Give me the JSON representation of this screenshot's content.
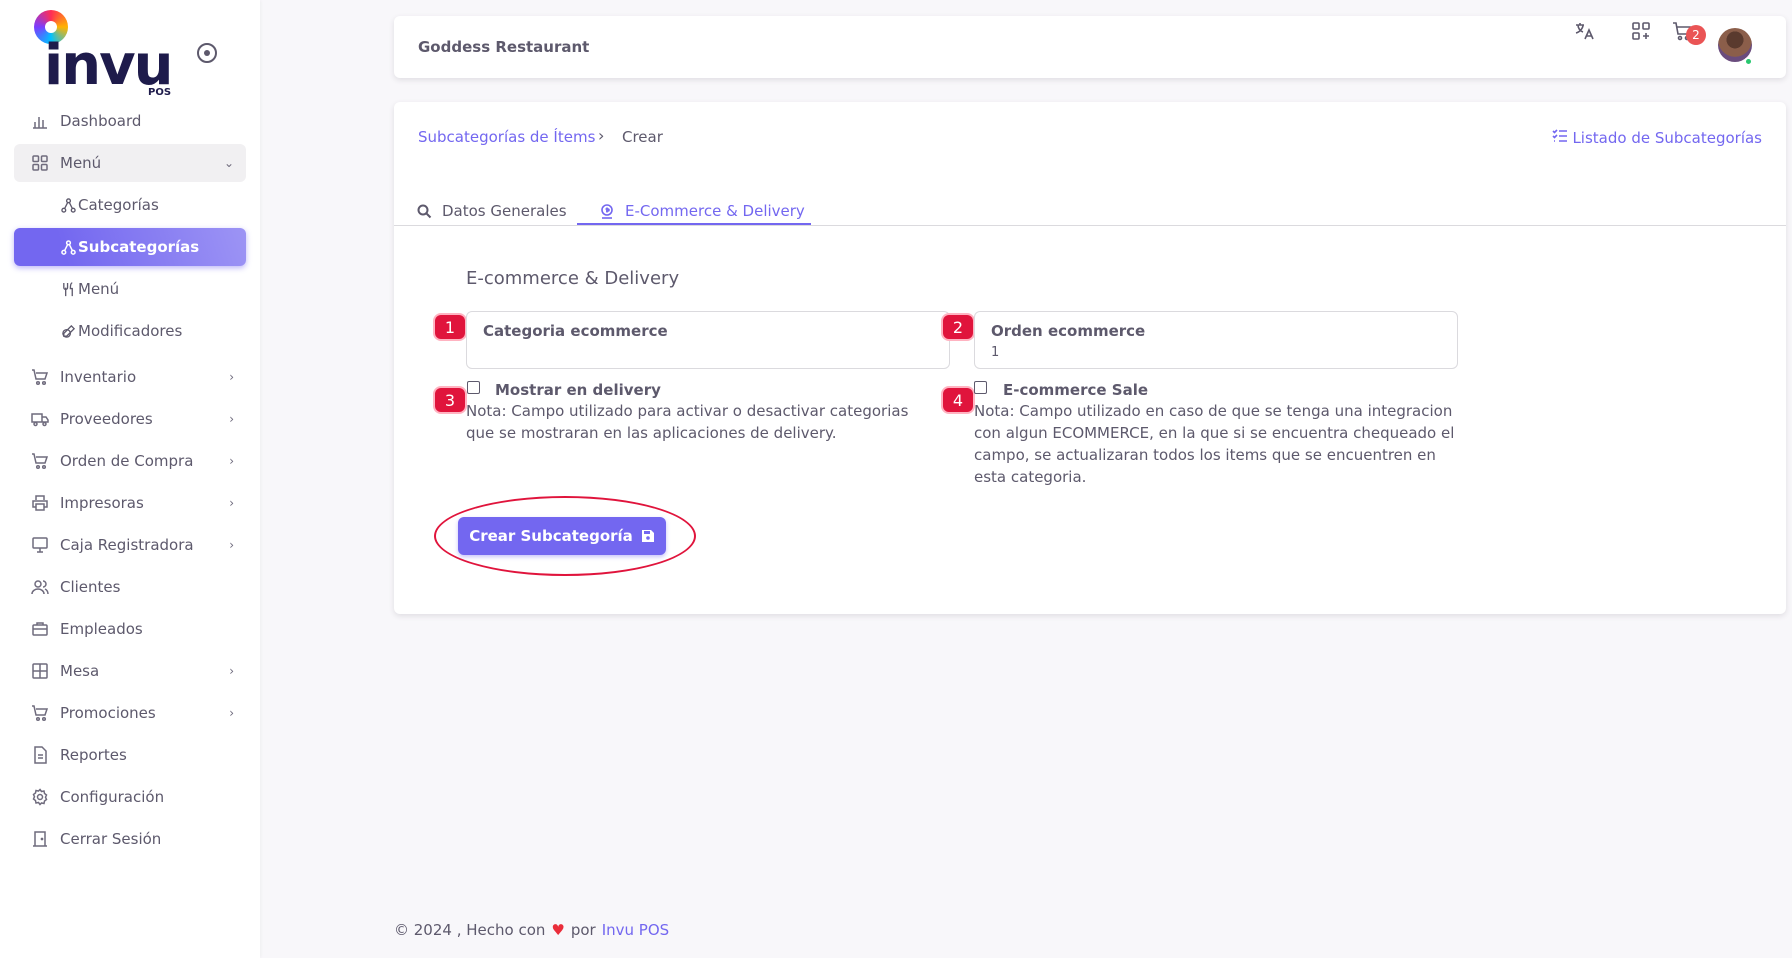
{
  "brand": {
    "logo_text": "invu",
    "logo_sub": "POS"
  },
  "sidebar": {
    "items": [
      {
        "label": "Dashboard"
      },
      {
        "label": "Menú"
      },
      {
        "label": "Categorías"
      },
      {
        "label": "Subcategorías"
      },
      {
        "label": "Menú"
      },
      {
        "label": "Modificadores"
      },
      {
        "label": "Inventario"
      },
      {
        "label": "Proveedores"
      },
      {
        "label": "Orden de Compra"
      },
      {
        "label": "Impresoras"
      },
      {
        "label": "Caja Registradora"
      },
      {
        "label": "Clientes"
      },
      {
        "label": "Empleados"
      },
      {
        "label": "Mesa"
      },
      {
        "label": "Promociones"
      },
      {
        "label": "Reportes"
      },
      {
        "label": "Configuración"
      },
      {
        "label": "Cerrar Sesión"
      }
    ]
  },
  "topbar": {
    "restaurant": "Goddess Restaurant",
    "cart_count": "2"
  },
  "breadcrumb": {
    "parent": "Subcategorías de Ítems",
    "separator": "›",
    "current": "Crear"
  },
  "list_link": "Listado de Subcategorías",
  "tabs": [
    {
      "label": "Datos Generales"
    },
    {
      "label": "E-Commerce & Delivery"
    }
  ],
  "form": {
    "section_title": "E-commerce & Delivery",
    "field1": {
      "badge": "1",
      "label": "Categoria ecommerce",
      "value": ""
    },
    "field2": {
      "badge": "2",
      "label": "Orden ecommerce",
      "value": "1"
    },
    "check1": {
      "badge": "3",
      "label": "Mostrar en delivery",
      "note": "Nota: Campo utilizado para activar o desactivar categorias que se mostraran en las aplicaciones de delivery."
    },
    "check2": {
      "badge": "4",
      "label": "E-commerce Sale",
      "note": "Nota: Campo utilizado en caso de que se tenga una integracion con algun ECOMMERCE, en la que si se encuentra chequeado el campo, se actualizaran todos los items que se encuentren en esta categoria."
    },
    "submit_label": "Crear Subcategoría"
  },
  "footer": {
    "prefix": "© 2024 , Hecho con",
    "by": "por",
    "brand": "Invu POS"
  },
  "colors": {
    "accent": "#7367f0",
    "annotation": "#e0143c",
    "badge": "#ea5455"
  }
}
